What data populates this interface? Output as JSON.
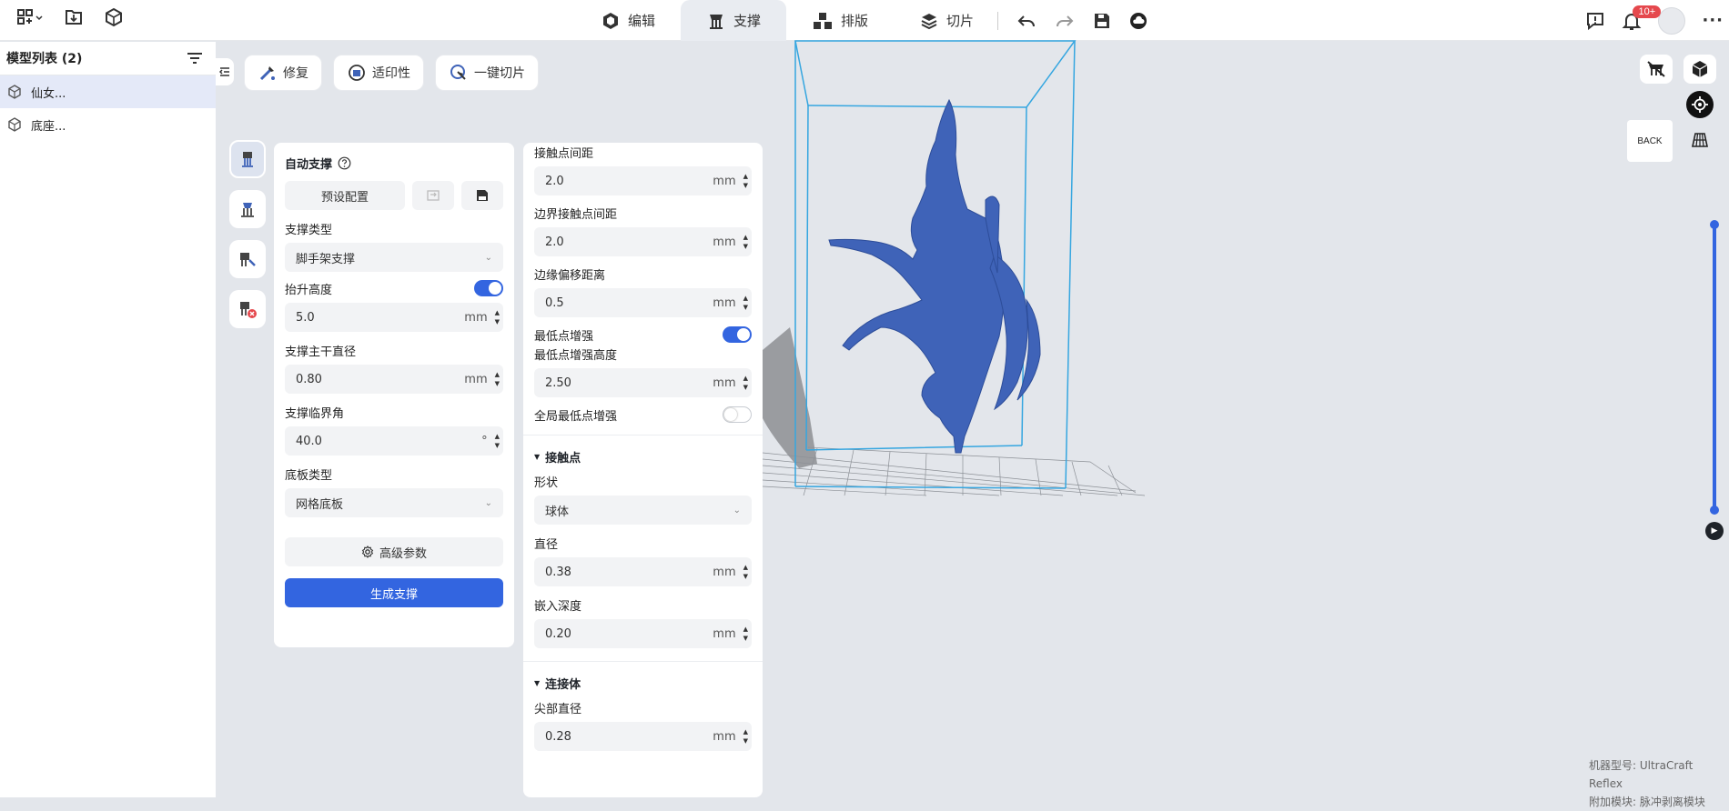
{
  "topbar": {
    "tabs": [
      {
        "label": "编辑",
        "icon": "edit-cube-icon",
        "active": false
      },
      {
        "label": "支撑",
        "icon": "support-icon",
        "active": true
      },
      {
        "label": "排版",
        "icon": "layout-icon",
        "active": false
      },
      {
        "label": "切片",
        "icon": "slice-icon",
        "active": false
      }
    ],
    "notification_badge": "10+"
  },
  "sidebar": {
    "title": "模型列表 (2)",
    "items": [
      {
        "label": "仙女...",
        "selected": true
      },
      {
        "label": "底座...",
        "selected": false
      }
    ]
  },
  "toolbar": {
    "repair": "修复",
    "printability": "适印性",
    "one_click_slice": "一键切片"
  },
  "auto_support": {
    "title": "自动支撑",
    "preset_btn": "预设配置",
    "support_type_label": "支撑类型",
    "support_type_value": "脚手架支撑",
    "lift_height_label": "抬升高度",
    "lift_height_enabled": true,
    "lift_height_value": "5.0",
    "lift_height_unit": "mm",
    "trunk_diameter_label": "支撑主干直径",
    "trunk_diameter_value": "0.80",
    "trunk_diameter_unit": "mm",
    "critical_angle_label": "支撑临界角",
    "critical_angle_value": "40.0",
    "critical_angle_unit": "°",
    "base_type_label": "底板类型",
    "base_type_value": "网格底板",
    "advanced_btn": "高级参数",
    "generate_btn": "生成支撑"
  },
  "advanced": {
    "contact_spacing_label": "接触点间距",
    "contact_spacing_value": "2.0",
    "edge_contact_spacing_label": "边界接触点间距",
    "edge_contact_spacing_value": "2.0",
    "edge_offset_label": "边缘偏移距离",
    "edge_offset_value": "0.5",
    "lowest_point_label": "最低点增强",
    "lowest_point_enabled": true,
    "lowest_point_height_label": "最低点增强高度",
    "lowest_point_height_value": "2.50",
    "global_lowest_label": "全局最低点增强",
    "global_lowest_enabled": false,
    "contact_section": "接触点",
    "shape_label": "形状",
    "shape_value": "球体",
    "diameter_label": "直径",
    "diameter_value": "0.38",
    "embed_depth_label": "嵌入深度",
    "embed_depth_value": "0.20",
    "connector_section": "连接体",
    "tip_diameter_label": "尖部直径",
    "tip_diameter_value": "0.28",
    "unit": "mm"
  },
  "viewport": {
    "back_label": "BACK",
    "model_color": "#3f63b8",
    "box_color": "#35a6e0"
  },
  "machine_info": {
    "model_line": "机器型号:  UltraCraft Reflex",
    "module_line": "附加模块:  脉冲剥离模块"
  }
}
